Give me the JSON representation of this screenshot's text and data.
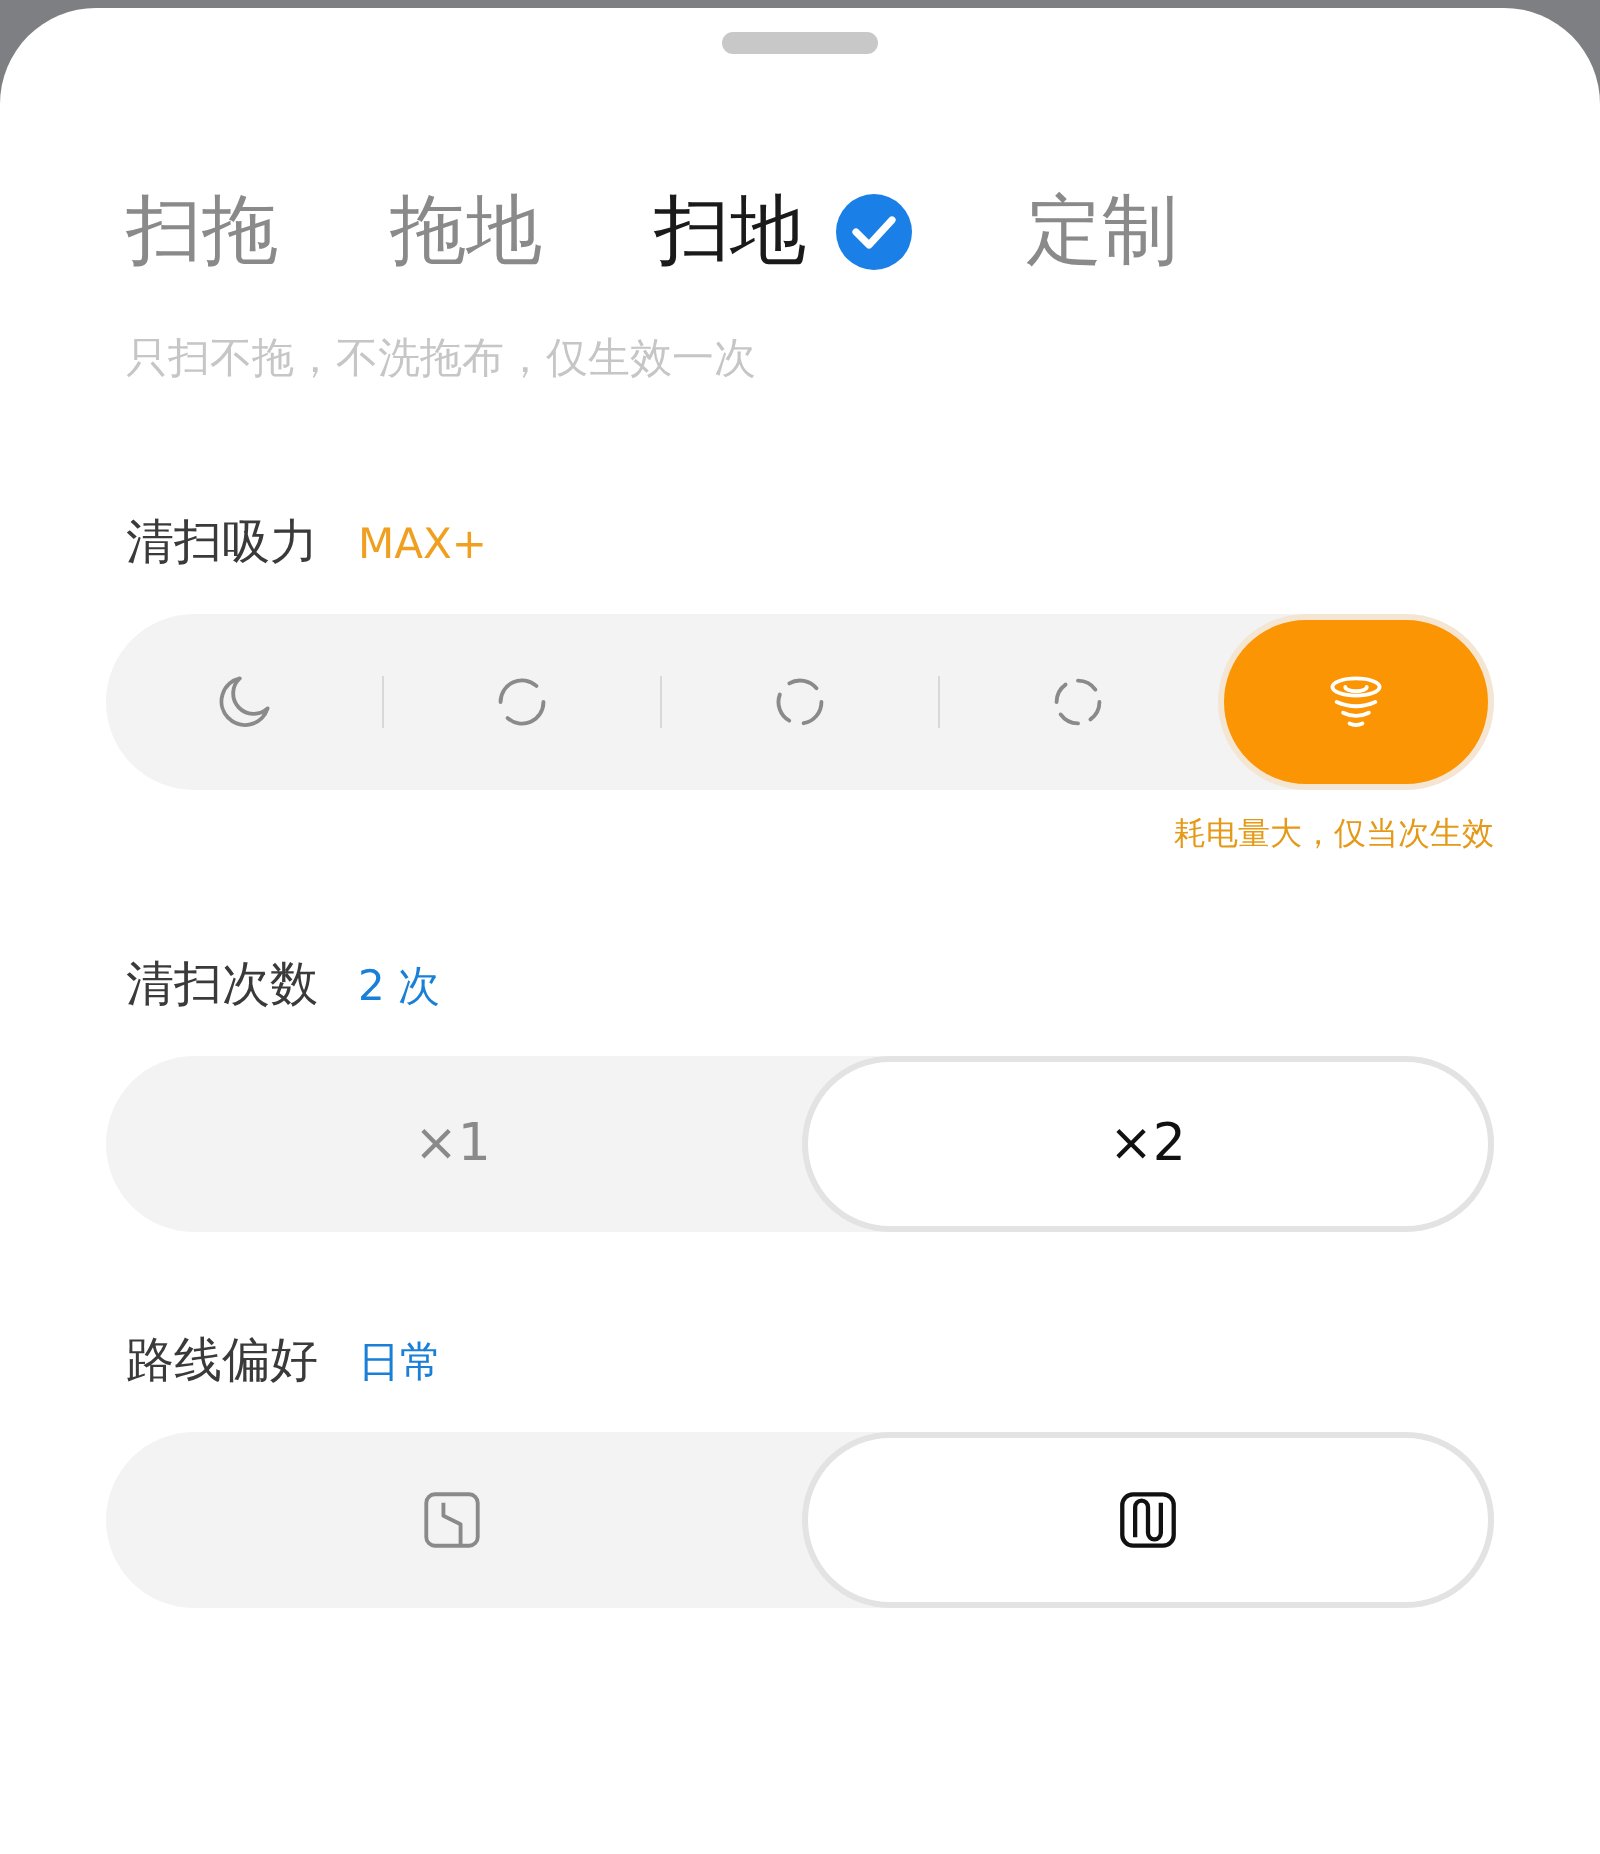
{
  "tabs": [
    {
      "label": "扫拖",
      "selected": false
    },
    {
      "label": "拖地",
      "selected": false
    },
    {
      "label": "扫地",
      "selected": true
    },
    {
      "label": "定制",
      "selected": false
    }
  ],
  "description": "只扫不拖，不洗拖布，仅生效一次",
  "sections": [
    {
      "label": "清扫吸力",
      "value": "MAX+",
      "color": "#f0a020",
      "options": [
        {
          "kind": "moon",
          "selected": false
        },
        {
          "kind": "swirl2",
          "selected": false
        },
        {
          "kind": "swirl3",
          "selected": false
        },
        {
          "kind": "swirl4",
          "selected": false
        },
        {
          "kind": "tornado",
          "selected": true
        }
      ],
      "note": "耗电量大，仅当次生效"
    },
    {
      "label": "清扫次数",
      "value": "2 次",
      "color": "#1a7fd6",
      "options": [
        {
          "kind": "text",
          "text": "×1",
          "selected": false
        },
        {
          "kind": "text",
          "text": "×2",
          "selected": true
        }
      ]
    },
    {
      "label": "路线偏好",
      "value": "日常",
      "color": "#1a7fd6",
      "options": [
        {
          "kind": "zigzag",
          "selected": false
        },
        {
          "kind": "serpentine",
          "selected": true
        }
      ]
    }
  ]
}
